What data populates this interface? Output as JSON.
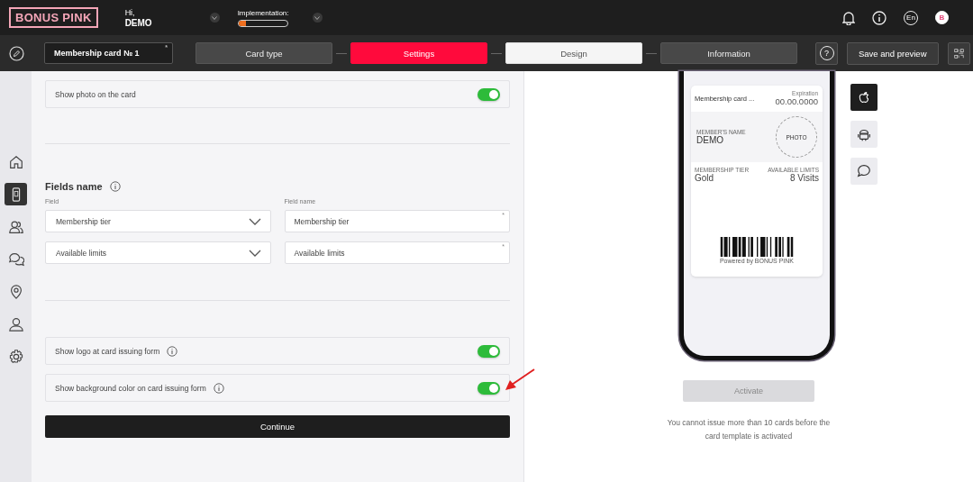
{
  "header": {
    "logo": "BONUS PINK",
    "greeting": "Hi,",
    "user": "DEMO",
    "implementation": {
      "label": "Implementation:",
      "level": 0.15
    },
    "language": "En",
    "avatar": "B"
  },
  "toolbar": {
    "card_name": {
      "value": "Membership card № 1",
      "required_mark": "*"
    },
    "steps": [
      {
        "label": "Card type",
        "selected": false,
        "highlighted": false
      },
      {
        "label": "Settings",
        "selected": true,
        "highlighted": false
      },
      {
        "label": "Design",
        "selected": false,
        "highlighted": true
      },
      {
        "label": "Information",
        "selected": false,
        "highlighted": false
      }
    ],
    "help": "?",
    "save_button": "Save and preview"
  },
  "sidebar": {
    "items": [
      {
        "selected": false
      },
      {
        "selected": true
      },
      {
        "selected": false
      },
      {
        "selected": false
      },
      {
        "selected": false
      },
      {
        "selected": false
      },
      {
        "selected": false
      }
    ]
  },
  "settings": {
    "top_toggles": [
      {
        "label": "Show photo on the card",
        "info": false,
        "on": true
      }
    ],
    "fields": {
      "title": "Fields name",
      "field_label": "Field",
      "name_label": "Field name",
      "rows": [
        {
          "field": "Membership tier",
          "name": "Membership tier",
          "required_mark": "*"
        },
        {
          "field": "Available limits",
          "name": "Available limits",
          "required_mark": "*"
        }
      ]
    },
    "bottom_toggles": [
      {
        "label": "Show logo at card issuing form",
        "info": true,
        "on": true
      },
      {
        "label": "Show background color on card issuing form",
        "info": true,
        "on": true
      }
    ],
    "continue_button": "Continue"
  },
  "preview": {
    "card": {
      "title": "Membership card ...",
      "expiration_label": "Expiration",
      "expiration": "00.00.0000",
      "member_label": "MEMBER'S NAME",
      "member": "DEMO",
      "photo": "PHOTO",
      "tier_label": "MEMBERSHIP TIER",
      "tier": "Gold",
      "limits_label": "AVAILABLE LIMITS",
      "limits": "8 Visits",
      "powered": "Powered by BONUS PINK"
    },
    "platforms": [
      {
        "selected": true
      },
      {
        "selected": false
      },
      {
        "selected": false
      }
    ],
    "activate": {
      "label": "Activate",
      "disabled": true
    },
    "note": "You cannot issue more than 10 cards before the card template is activated"
  }
}
